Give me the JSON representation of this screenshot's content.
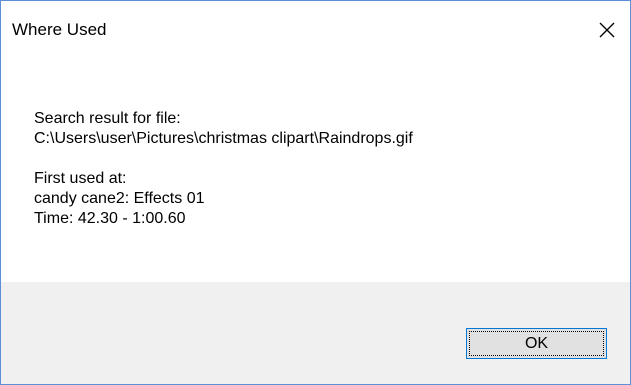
{
  "window": {
    "title": "Where Used",
    "close_icon": "close-icon"
  },
  "message": {
    "header": "Search result for file:",
    "file_path": "C:\\Users\\user\\Pictures\\christmas clipart\\Raindrops.gif",
    "first_used_label": "First used at:",
    "location": "candy cane2: Effects 01",
    "time": "Time: 42.30 - 1:00.60"
  },
  "buttons": {
    "ok_label": "OK"
  },
  "colors": {
    "window_border": "#5c8fd6",
    "footer_background": "#f0f0f0",
    "button_border": "#0078d7",
    "button_background": "#e1e1e1"
  }
}
